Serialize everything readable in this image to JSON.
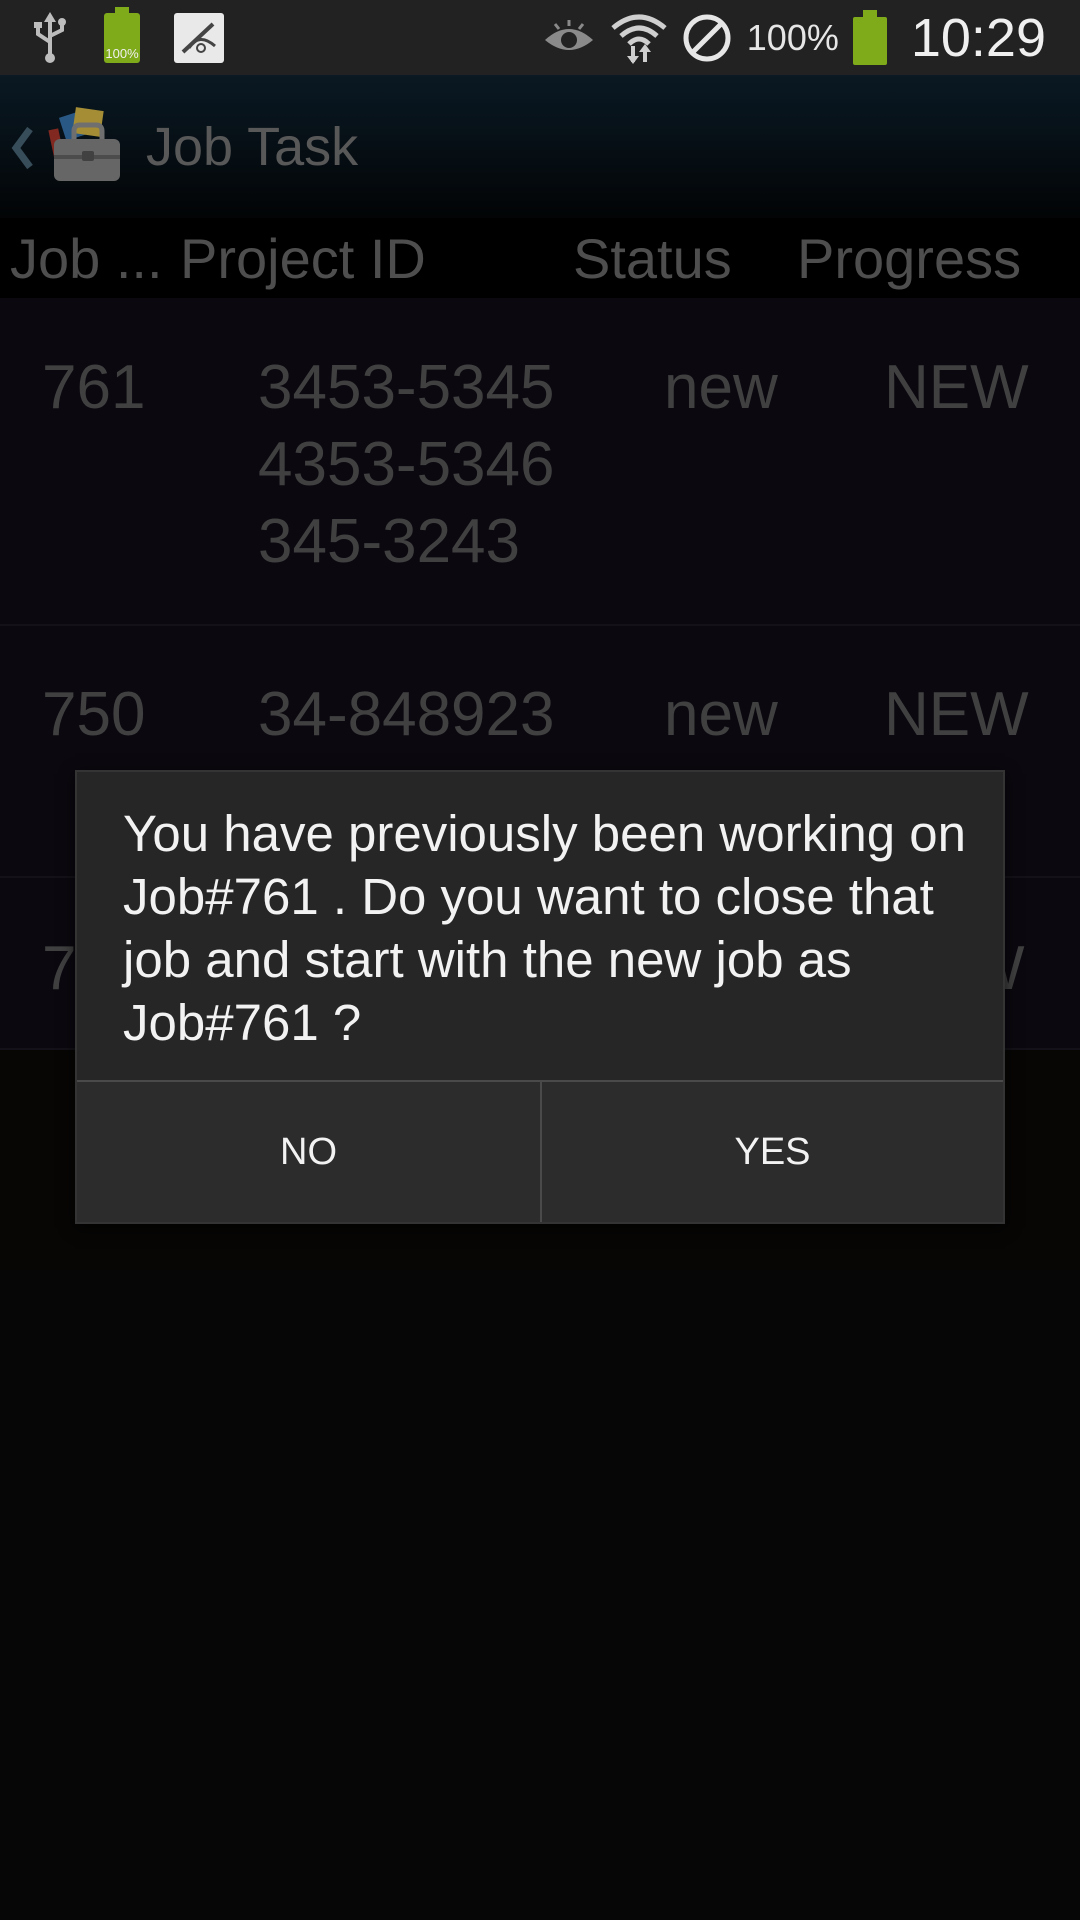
{
  "status_bar": {
    "left_icons": [
      "usb-icon",
      "battery-charged-icon",
      "gallery-icon"
    ],
    "small_battery_label": "100%",
    "right_icons": [
      "eye-icon",
      "wifi-icon",
      "block-icon",
      "battery-icon"
    ],
    "battery_percent": "100%",
    "time": "10:29",
    "accent_color": "#7fab1b"
  },
  "action_bar": {
    "title": "Job Task",
    "back_icon": "chevron-left-icon",
    "app_icon": "toolbox-icon"
  },
  "table": {
    "headers": [
      "Job ...",
      "Project ID",
      "Status",
      "Progress"
    ],
    "rows": [
      {
        "job": "761",
        "project_ids": [
          "3453-5345",
          "4353-5346",
          "345-3243"
        ],
        "status": "new",
        "progress": "NEW"
      },
      {
        "job": "750",
        "project_ids": [
          "34-848923"
        ],
        "status": "new",
        "progress": "NEW"
      },
      {
        "job": "7",
        "project_ids": [],
        "status": "",
        "progress": "W"
      }
    ]
  },
  "dialog": {
    "message": "You have previously been working on Job#761 . Do you want to close that job and start with the new job as Job#761 ?",
    "no_label": "NO",
    "yes_label": "YES"
  }
}
